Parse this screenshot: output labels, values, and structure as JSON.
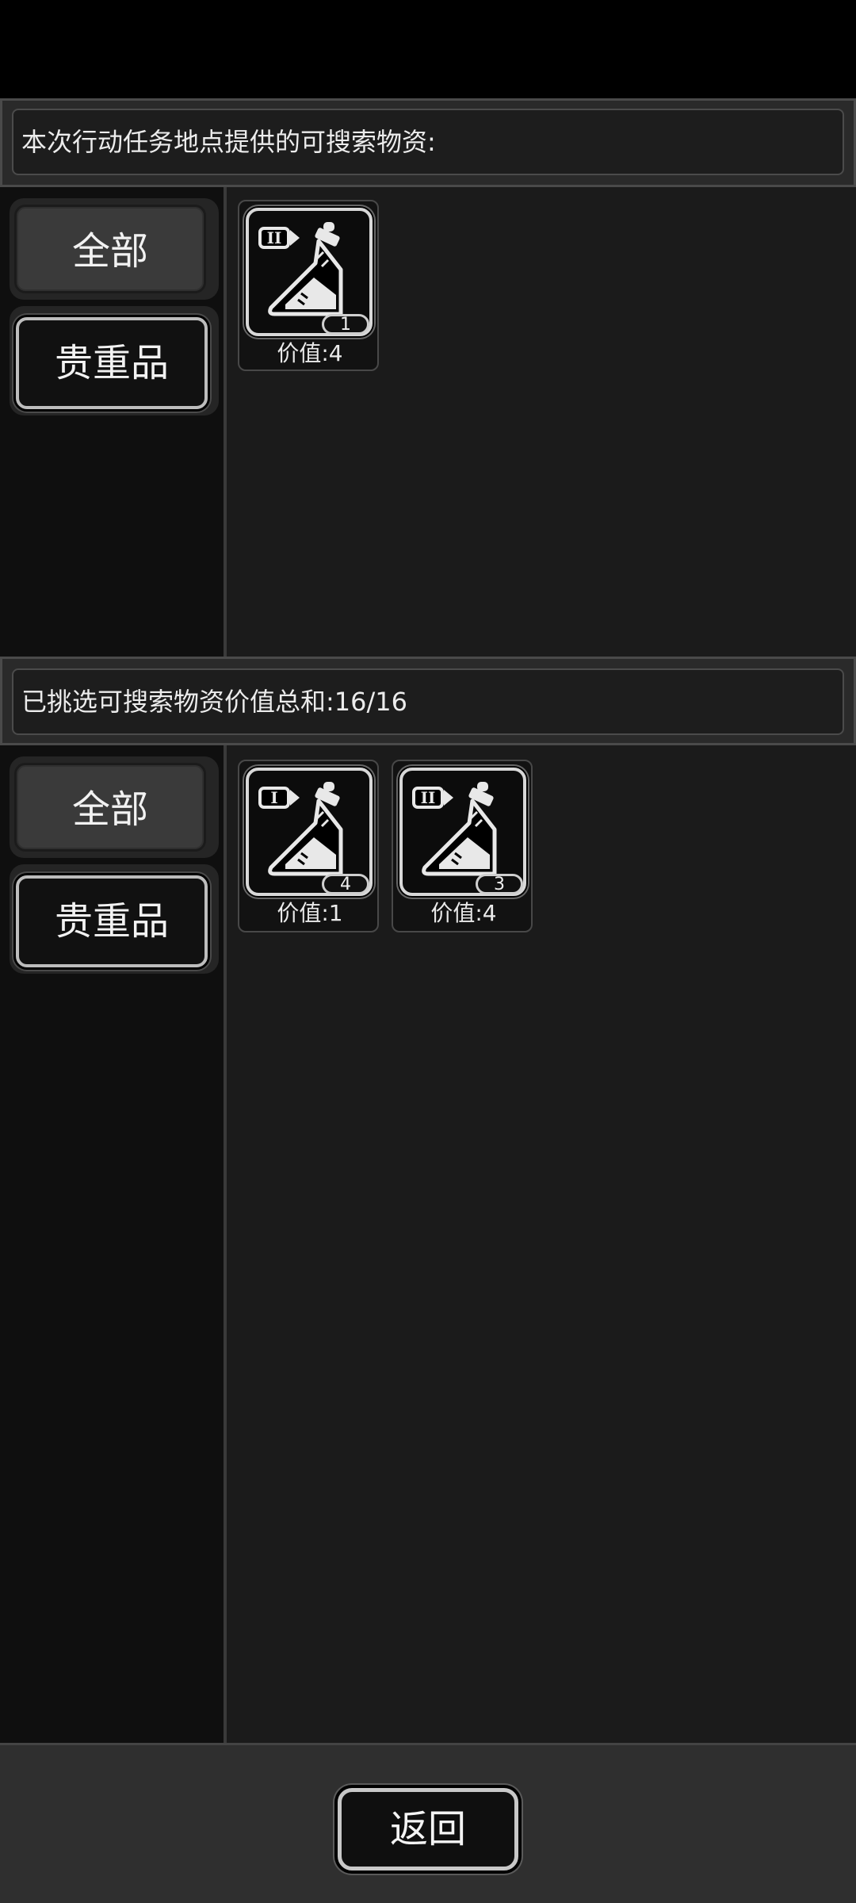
{
  "top_section": {
    "header": "本次行动任务地点提供的可搜索物资:",
    "tabs": {
      "all": "全部",
      "valuable": "贵重品"
    },
    "items": [
      {
        "tier": "II",
        "count": "1",
        "value": "价值:4",
        "icon": "flask-icon"
      }
    ]
  },
  "bottom_section": {
    "header": "已挑选可搜索物资价值总和:16/16",
    "tabs": {
      "all": "全部",
      "valuable": "贵重品"
    },
    "items": [
      {
        "tier": "I",
        "count": "4",
        "value": "价值:1",
        "icon": "flask-icon"
      },
      {
        "tier": "II",
        "count": "3",
        "value": "价值:4",
        "icon": "flask-icon"
      }
    ]
  },
  "footer": {
    "back_label": "返回"
  }
}
